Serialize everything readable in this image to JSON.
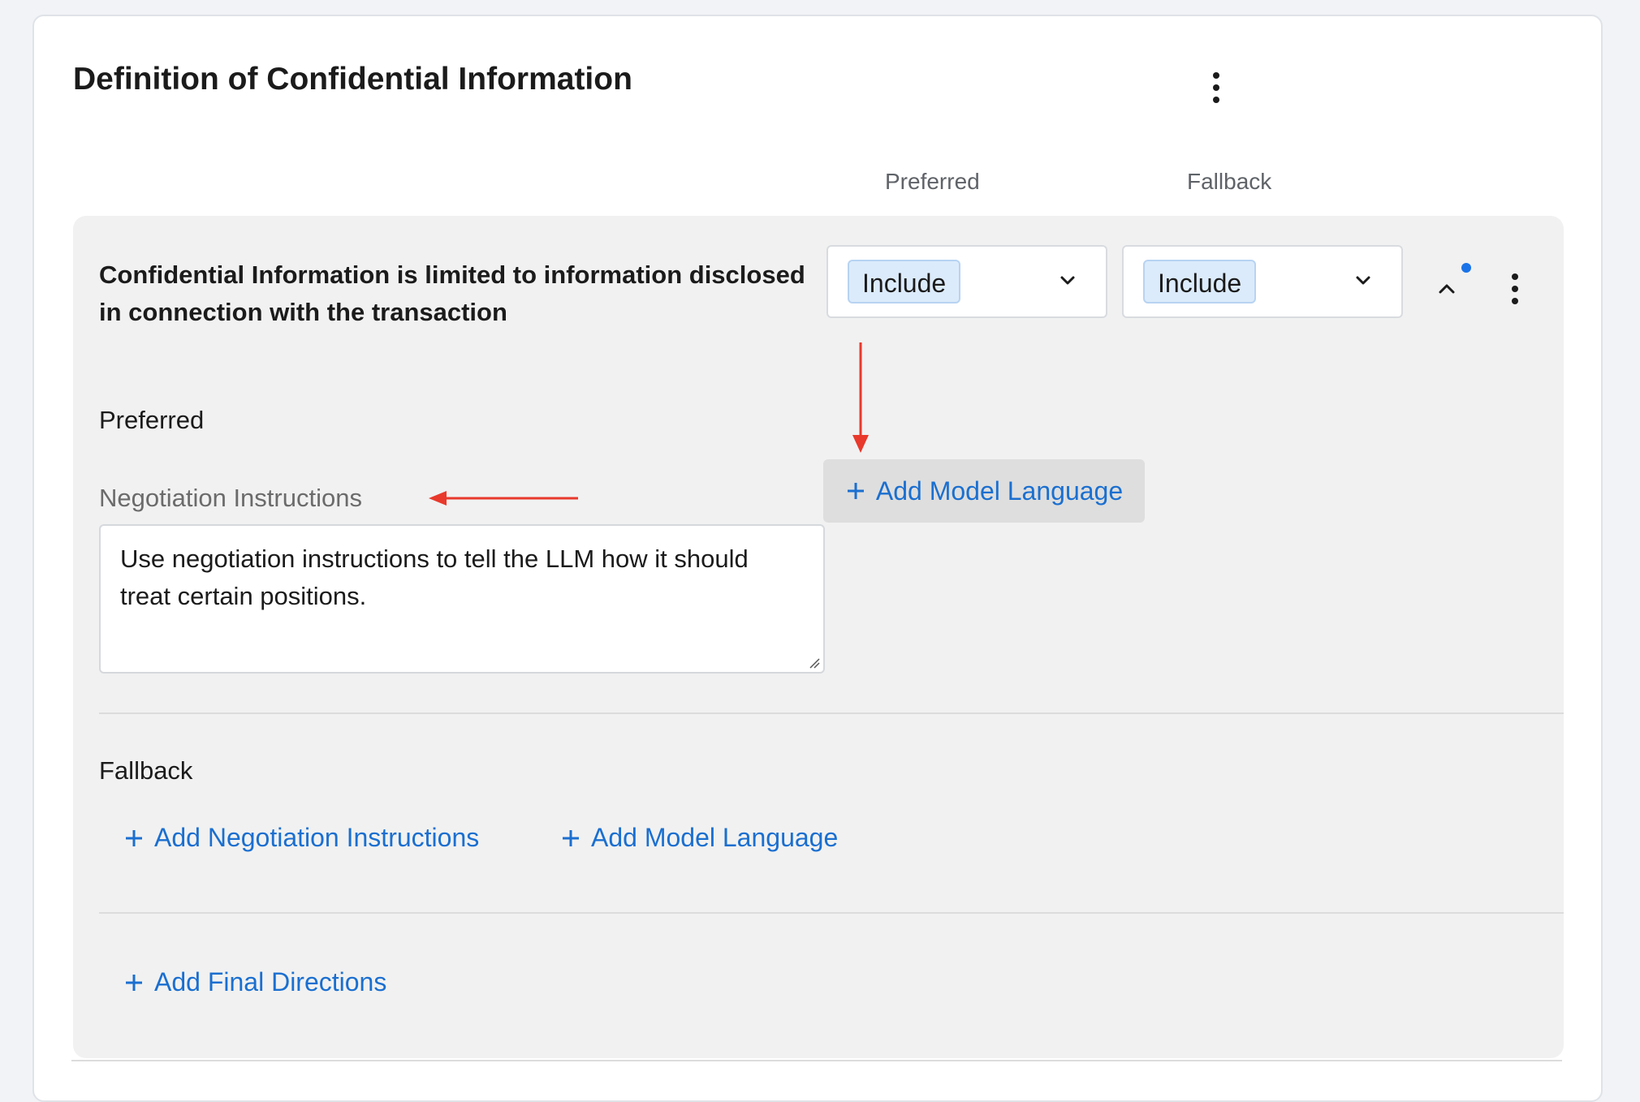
{
  "card": {
    "title": "Definition of Confidential Information"
  },
  "columns": {
    "preferred": "Preferred",
    "fallback": "Fallback"
  },
  "clause": {
    "text": "Confidential Information is limited to information disclosed in connection with the transaction",
    "preferred_value": "Include",
    "fallback_value": "Include",
    "preferred_section": {
      "label": "Preferred",
      "instructions_label": "Negotiation Instructions",
      "instructions_text": "Use negotiation instructions to tell the LLM how it should treat certain positions.",
      "add_model_language": "Add Model Language"
    },
    "fallback_section": {
      "label": "Fallback",
      "add_negotiation_instructions": "Add Negotiation Instructions",
      "add_model_language": "Add Model Language"
    },
    "add_final_directions": "Add Final Directions"
  },
  "colors": {
    "accent": "#1a6fd0",
    "annotation_arrow": "#e8392c",
    "indicator_dot": "#1a73e8"
  },
  "icons": [
    "more-vertical-icon",
    "chevron-down-icon",
    "chevron-up-icon",
    "plus-icon",
    "resize-handle-icon"
  ]
}
